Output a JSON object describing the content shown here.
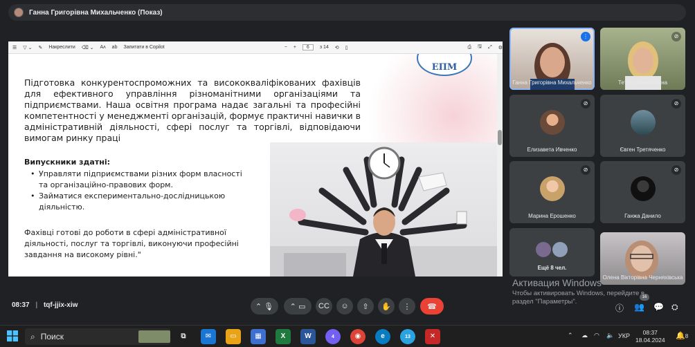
{
  "presenter": {
    "name": "Ганна Григорівна Михальченко (Показ)"
  },
  "viewer_toolbar": {
    "draw_label": "Накреслити",
    "copilot_label": "Запитати в Copilot",
    "page_current": "6",
    "page_total": "з 14",
    "zoom_minus": "−",
    "zoom_plus": "+"
  },
  "slide": {
    "logo_text": "ЕПМ",
    "intro": "Підготовка конкурентоспроможних та висококваліфікованих фахівців для ефективного управління різноманітними організаціями та підприємствами. Наша освітня програма надає загальні та професійні компетентності у менеджменті організацій, формує практичні навички в адміністративній діяльності, сфері послуг та торгівлі, відповідаючи вимогам ринку праці",
    "graduates_heading": "Випускники здатні:",
    "graduates": [
      "Управляти підприємствами різних форм власності та організаційно-правових форм.",
      "Займатися експериментально-дослідницькою діяльністю."
    ],
    "ready": "Фахівці готові до роботи в сфері адміністративної діяльності, послуг та торгівлі, виконуючи професійні завдання на високому рівні.\""
  },
  "participants": [
    {
      "name": "Ганна Григорівна Михальченко"
    },
    {
      "name": "Тетяна Миколаївна"
    },
    {
      "name": "Елизавета Ивченко"
    },
    {
      "name": "Євген Третяченко"
    },
    {
      "name": "Марина Ерошенко"
    },
    {
      "name": "Ганжа Данило"
    },
    {
      "name": "Ещё 8 чел."
    },
    {
      "name": "Олена Вікторівна Черняхівська"
    }
  ],
  "meeting": {
    "time": "08:37",
    "code": "tqf-jjix-xiw",
    "participant_count": "16"
  },
  "activation": {
    "title": "Активация Windows",
    "text": "Чтобы активировать Windows, перейдите в раздел \"Параметры\"."
  },
  "taskbar": {
    "search_placeholder": "Поиск",
    "lang": "УКР",
    "time": "08:37",
    "date": "18.04.2024",
    "badge_viber": "4",
    "badge_telegram": "13",
    "notifications": "8"
  },
  "colors": {
    "bg": "#202124",
    "tile": "#3c4043",
    "end_call": "#ea4335",
    "highlight": "#8ab4f8"
  }
}
